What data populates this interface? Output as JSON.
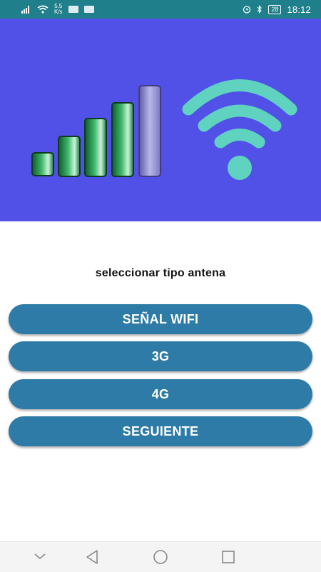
{
  "status_bar": {
    "speed_value": "5.5",
    "speed_unit": "K/s",
    "battery": "28",
    "time": "18:12",
    "icons": [
      "signal-icon",
      "wifi-icon",
      "notification-icon",
      "chat-icon",
      "alarm-icon",
      "bluetooth-icon",
      "battery-icon"
    ]
  },
  "hero": {
    "background": "#5151e8",
    "signal_bar_color": "#2aa55a",
    "wifi_color": "#5fd3c0",
    "icons": [
      "signal-bars-icon",
      "wifi-icon"
    ]
  },
  "main": {
    "prompt": "seleccionar tipo antena",
    "buttons": [
      {
        "label": "SEÑAL WIFI"
      },
      {
        "label": "3G"
      },
      {
        "label": "4G"
      },
      {
        "label": "SEGUIENTE"
      }
    ],
    "button_color": "#2d7ba6"
  },
  "nav_bar": {
    "icons": [
      "chevron-down-icon",
      "back-icon",
      "home-icon",
      "recents-icon"
    ]
  }
}
